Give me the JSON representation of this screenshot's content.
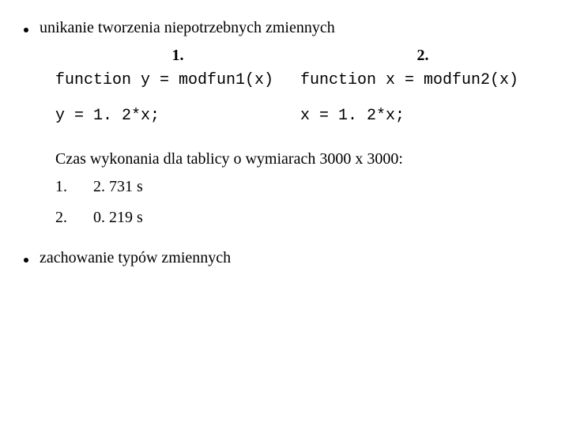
{
  "bullet1": "unikanie tworzenia niepotrzebnych zmiennych",
  "cols": {
    "left": {
      "heading": "1.",
      "line1": "function y = modfun1(x)",
      "line2": "y = 1. 2*x;"
    },
    "right": {
      "heading": "2.",
      "line1": "function x = modfun2(x)",
      "line2": "x = 1. 2*x;"
    }
  },
  "caption": "Czas wykonania dla tablicy o wymiarach 3000 x 3000:",
  "results": [
    {
      "n": "1.",
      "t": "2. 731 s"
    },
    {
      "n": "2.",
      "t": "0. 219 s"
    }
  ],
  "bullet2": "zachowanie typów zmiennych"
}
